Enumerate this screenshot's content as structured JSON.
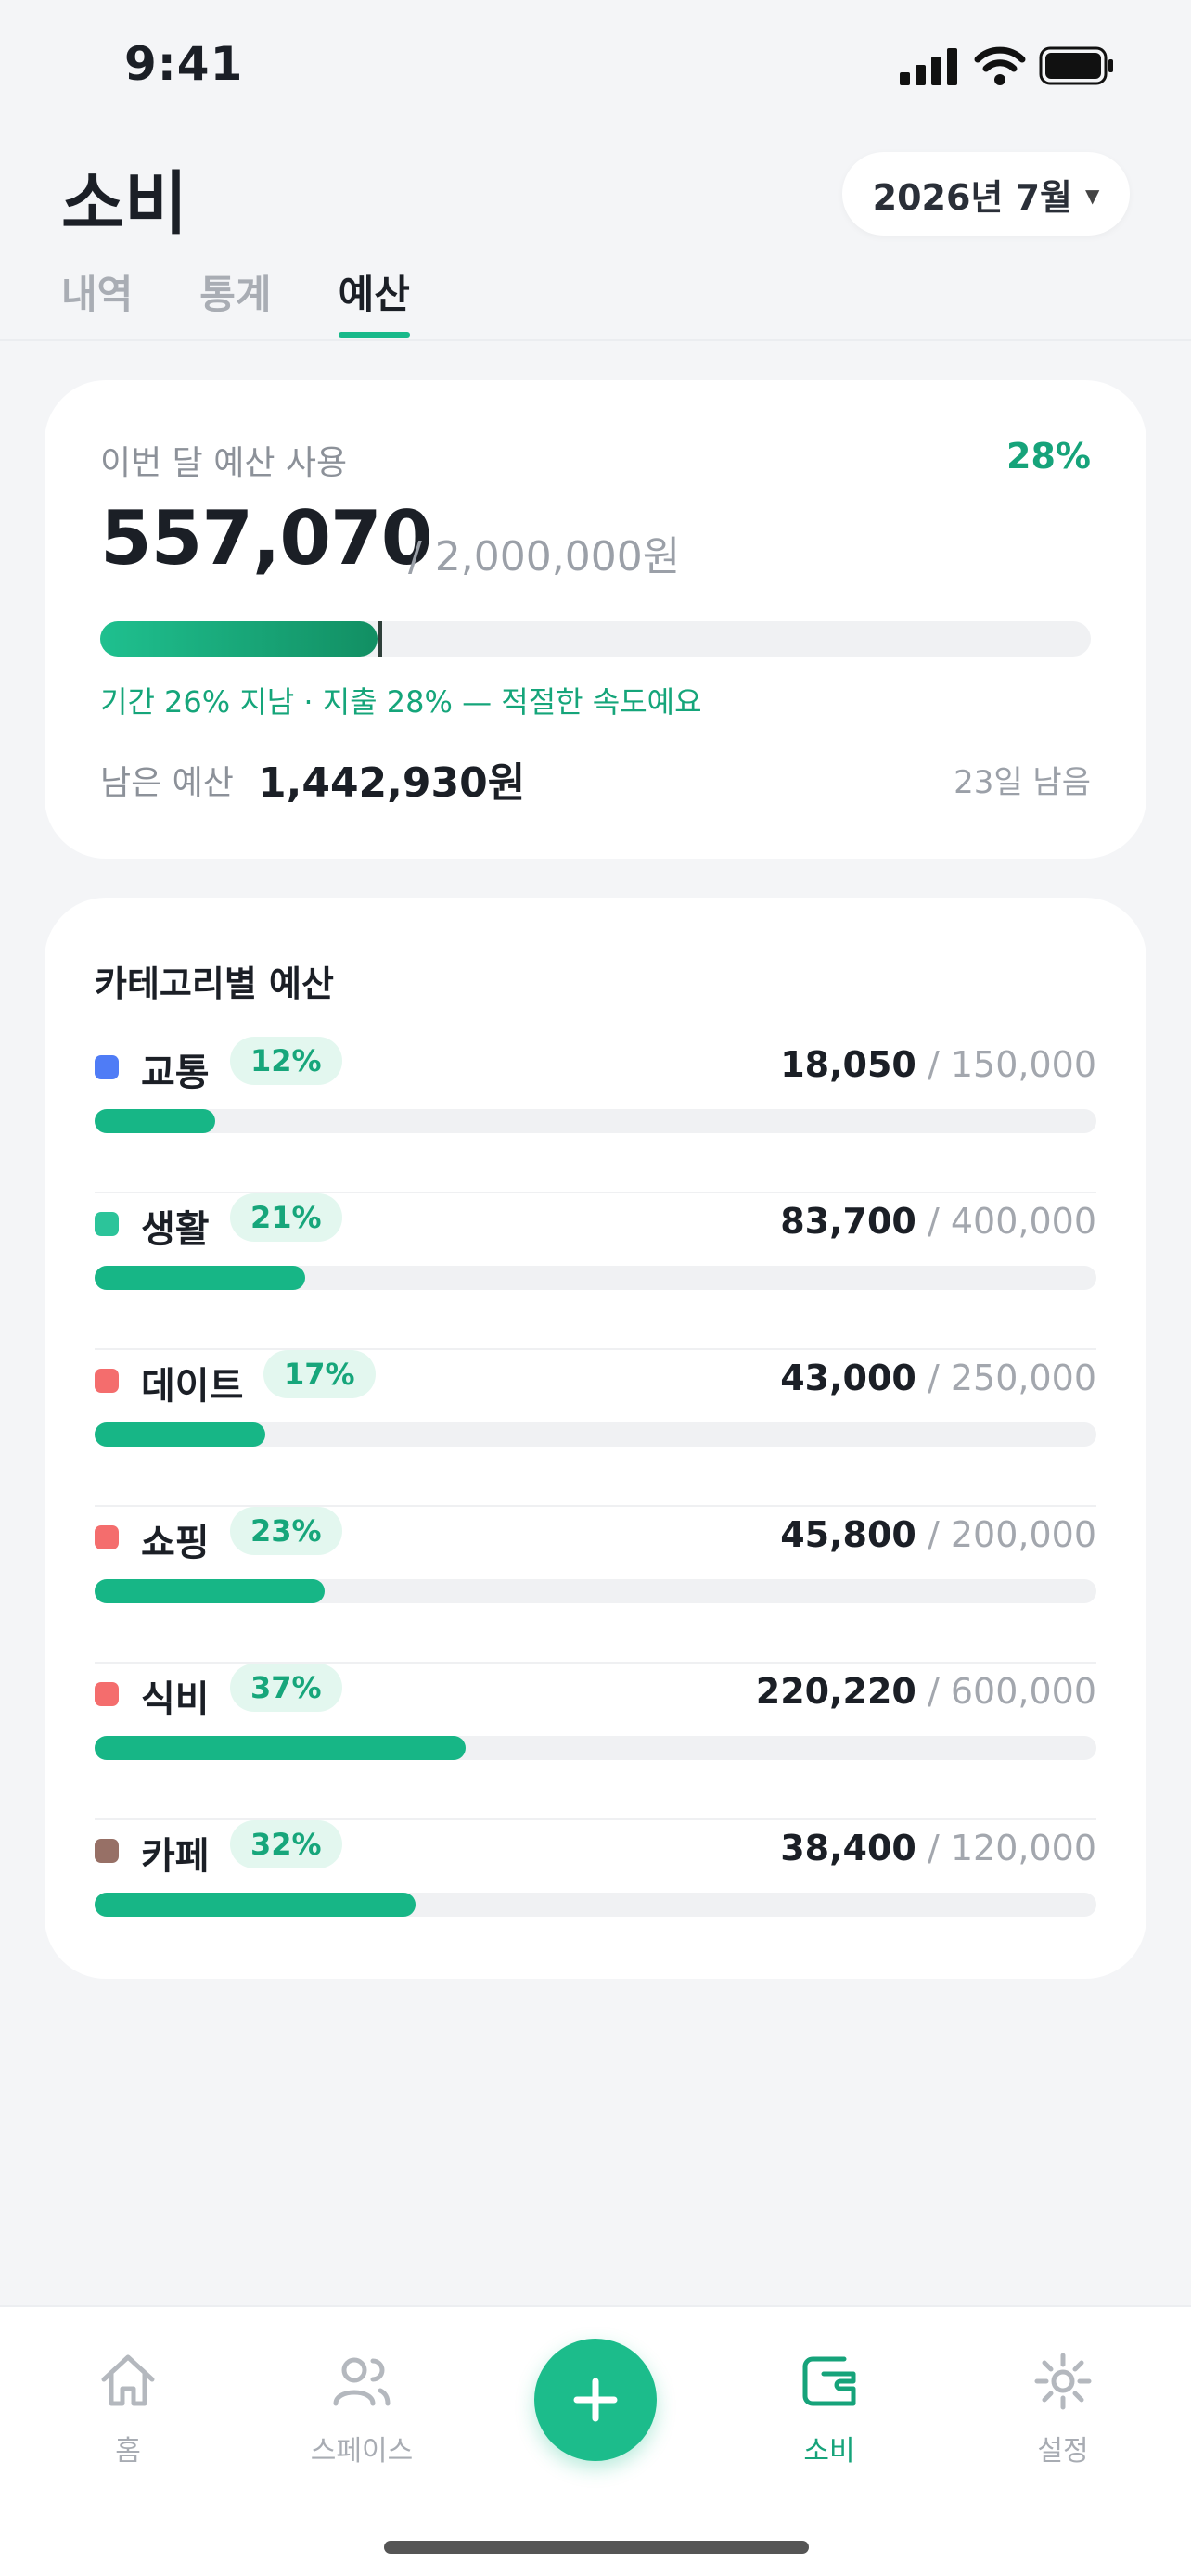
{
  "status_bar": {
    "time": "9:41"
  },
  "header": {
    "title": "소비",
    "month": "2026년 7월"
  },
  "tabs": [
    {
      "label": "내역",
      "active": false
    },
    {
      "label": "통계",
      "active": false
    },
    {
      "label": "예산",
      "active": true
    }
  ],
  "summary": {
    "label": "이번 달 예산 사용",
    "percent_text": "28%",
    "spent": "557,070",
    "total": "/ 2,000,000원",
    "progress": 0.28,
    "period_marker": 0.26,
    "pace_text": "기간 26% 지남 · 지출 28% — 적절한 속도예요",
    "remaining_label": "남은 예산",
    "remaining_value": "1,442,930원",
    "days_left": "23일 남음"
  },
  "categories_title": "카테고리별 예산",
  "categories": [
    {
      "name": "교통",
      "percent": "12%",
      "spent": "18,050",
      "limit": "/ 150,000",
      "ratio": 0.12,
      "color": "#4f7cf6"
    },
    {
      "name": "생활",
      "percent": "21%",
      "spent": "83,700",
      "limit": "/ 400,000",
      "ratio": 0.21,
      "color": "#2cc49a"
    },
    {
      "name": "데이트",
      "percent": "17%",
      "spent": "43,000",
      "limit": "/ 250,000",
      "ratio": 0.17,
      "color": "#f46d6d"
    },
    {
      "name": "쇼핑",
      "percent": "23%",
      "spent": "45,800",
      "limit": "/ 200,000",
      "ratio": 0.23,
      "color": "#f46d6d"
    },
    {
      "name": "식비",
      "percent": "37%",
      "spent": "220,220",
      "limit": "/ 600,000",
      "ratio": 0.37,
      "color": "#f46d6d"
    },
    {
      "name": "카페",
      "percent": "32%",
      "spent": "38,400",
      "limit": "/ 120,000",
      "ratio": 0.32,
      "color": "#977066"
    }
  ],
  "nav": {
    "home": "홈",
    "spaces": "스페이스",
    "spending": "소비",
    "settings": "설정"
  },
  "colors": {
    "accent": "#1cbc8b",
    "accent_text": "#16a37a"
  }
}
